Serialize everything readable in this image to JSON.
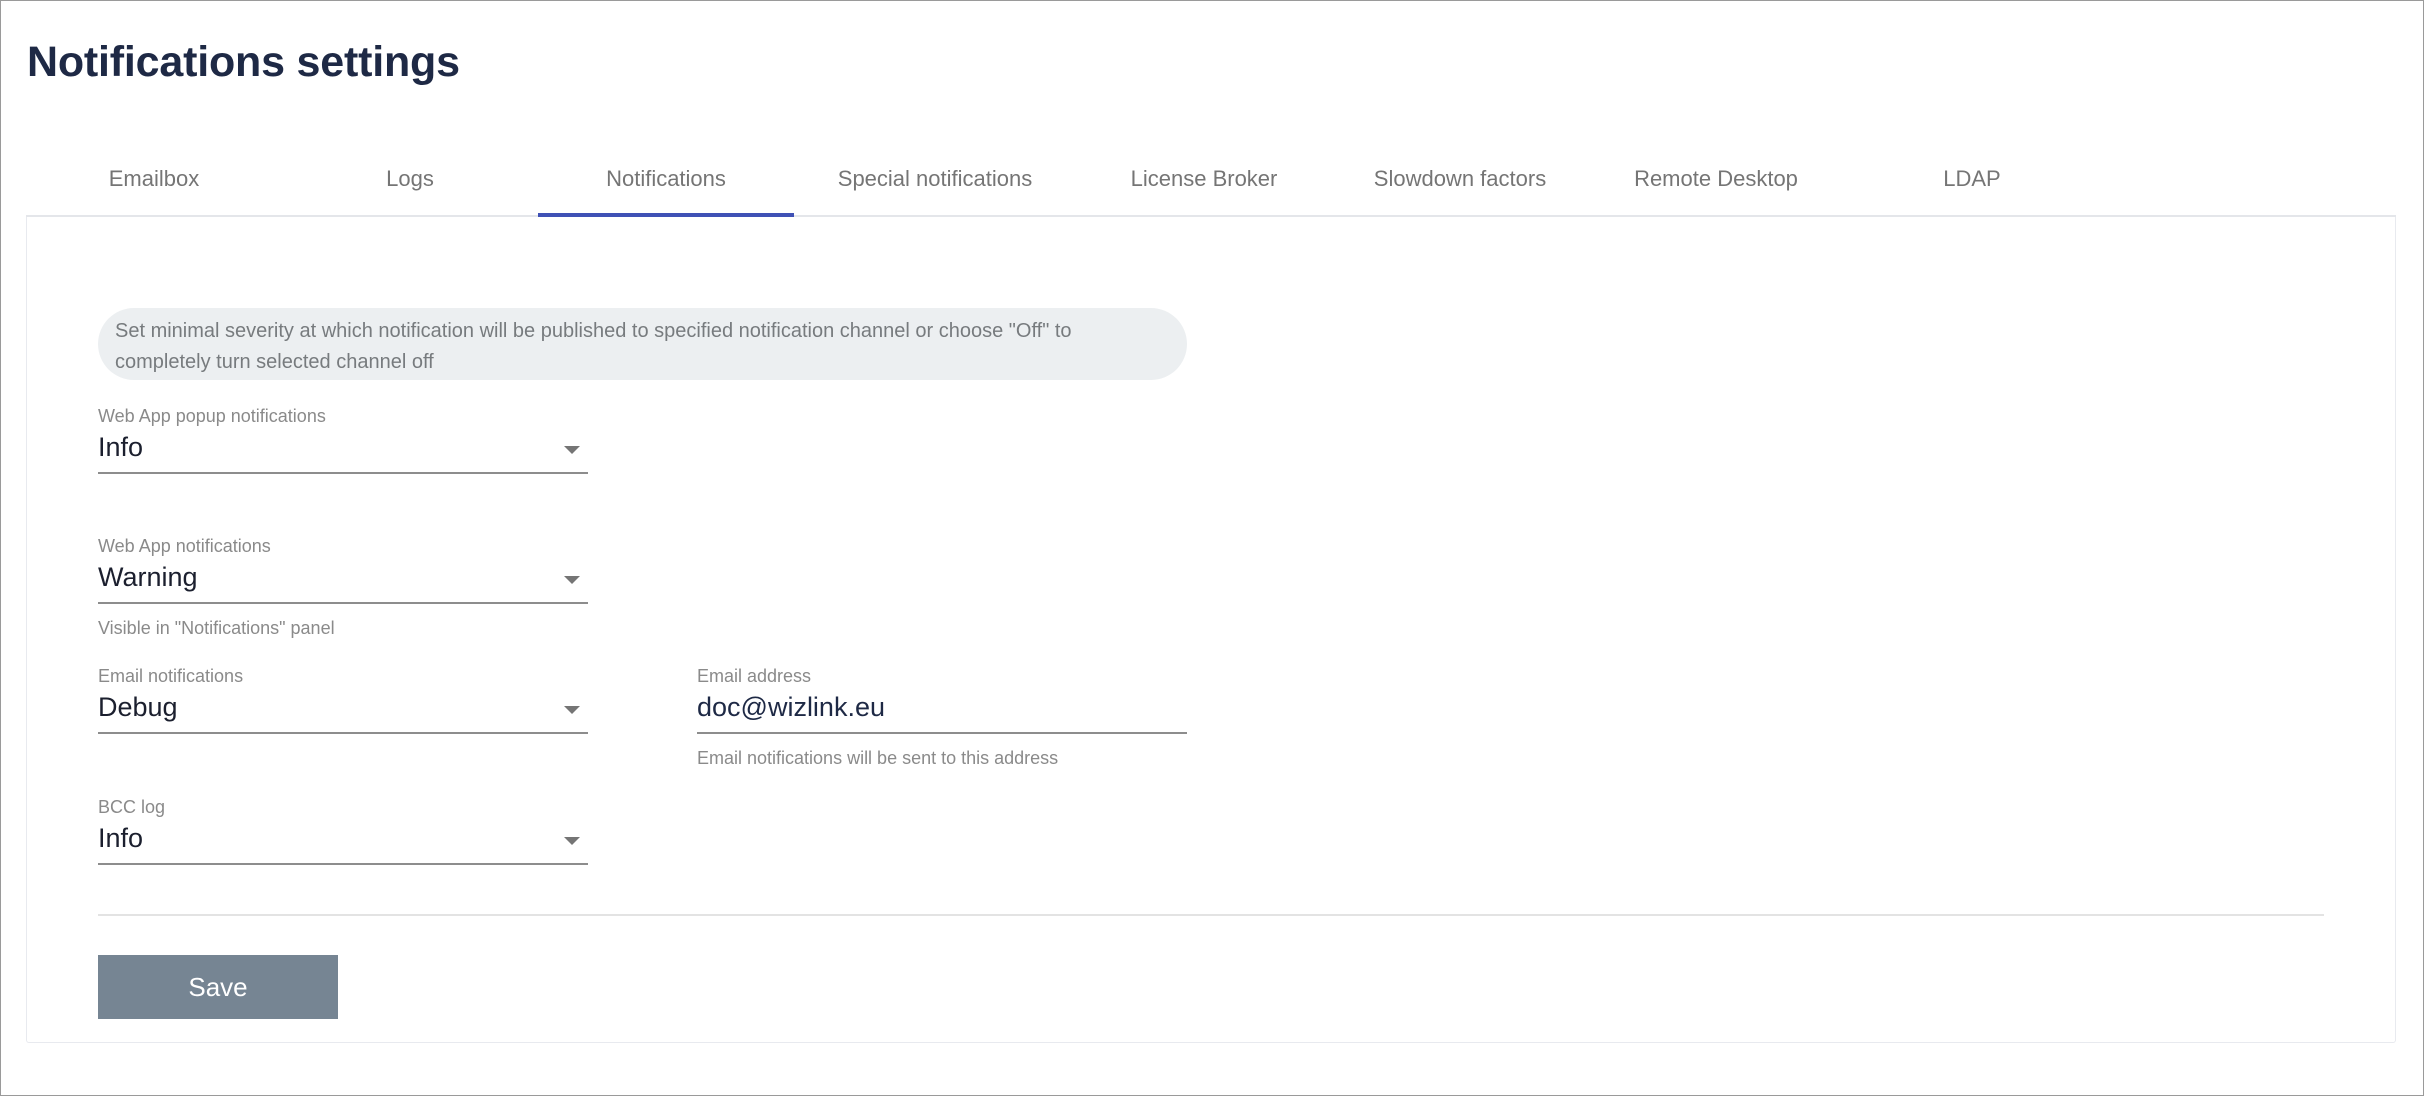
{
  "page": {
    "title": "Notifications settings"
  },
  "tabs": [
    {
      "label": "Emailbox",
      "active": false
    },
    {
      "label": "Logs",
      "active": false
    },
    {
      "label": "Notifications",
      "active": true
    },
    {
      "label": "Special notifications",
      "active": false
    },
    {
      "label": "License Broker",
      "active": false
    },
    {
      "label": "Slowdown factors",
      "active": false
    },
    {
      "label": "Remote Desktop",
      "active": false
    },
    {
      "label": "LDAP",
      "active": false
    }
  ],
  "info": {
    "text": "Set minimal severity at which notification will be published to specified notification channel or choose \"Off\" to completely turn selected channel off"
  },
  "fields": {
    "web_app_popup": {
      "label": "Web App popup notifications",
      "value": "Info",
      "icon": "dropdown-arrow-icon"
    },
    "web_app": {
      "label": "Web App notifications",
      "value": "Warning",
      "hint": "Visible in \"Notifications\" panel",
      "icon": "dropdown-arrow-icon"
    },
    "email_notifications": {
      "label": "Email notifications",
      "value": "Debug",
      "icon": "dropdown-arrow-icon"
    },
    "email_address": {
      "label": "Email address",
      "value": "doc@wizlink.eu",
      "hint": "Email notifications will be sent to this address"
    },
    "bcc_log": {
      "label": "BCC log",
      "value": "Info",
      "icon": "dropdown-arrow-icon"
    }
  },
  "actions": {
    "save_label": "Save"
  },
  "colors": {
    "title": "#1e2945",
    "active_tab_indicator": "#3f51b5",
    "info_background": "#eceff1",
    "save_button": "#768593"
  }
}
